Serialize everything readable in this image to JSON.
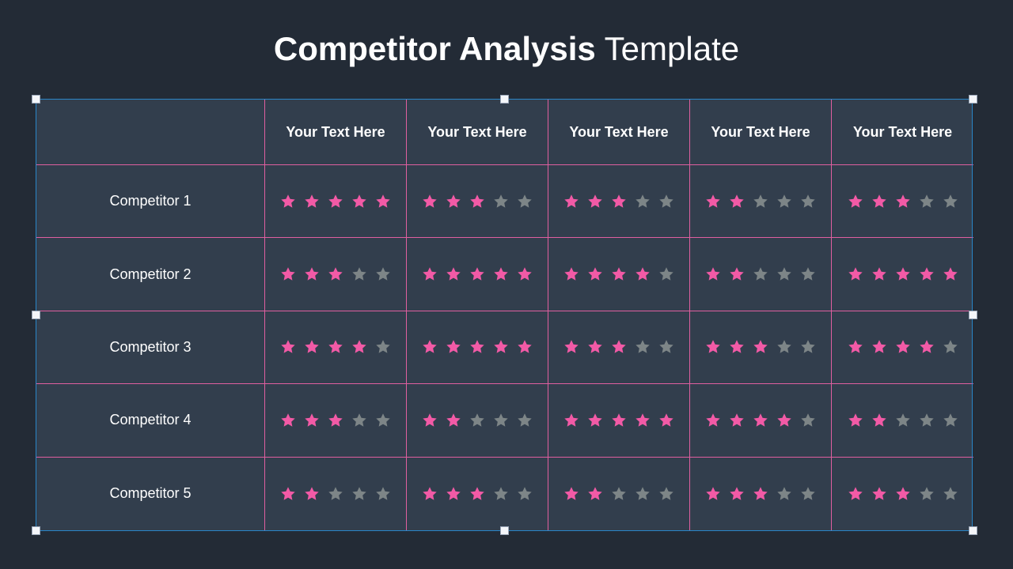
{
  "title": {
    "bold": "Competitor Analysis",
    "light": "Template"
  },
  "colors": {
    "filled_star": "#f25aa6",
    "empty_star": "#7d8587",
    "grid_line": "#e05fa0",
    "selection": "#2a86c8"
  },
  "table": {
    "headers": [
      "Your Text Here",
      "Your Text Here",
      "Your Text Here",
      "Your Text Here",
      "Your Text Here"
    ],
    "max_rating": 5,
    "rows": [
      {
        "label": "Competitor 1",
        "ratings": [
          5,
          3,
          3,
          2,
          3
        ]
      },
      {
        "label": "Competitor 2",
        "ratings": [
          3,
          5,
          4,
          2,
          5
        ]
      },
      {
        "label": "Competitor 3",
        "ratings": [
          4,
          5,
          3,
          3,
          4
        ]
      },
      {
        "label": "Competitor 4",
        "ratings": [
          3,
          2,
          5,
          4,
          2
        ]
      },
      {
        "label": "Competitor 5",
        "ratings": [
          2,
          3,
          2,
          3,
          3
        ]
      }
    ]
  }
}
